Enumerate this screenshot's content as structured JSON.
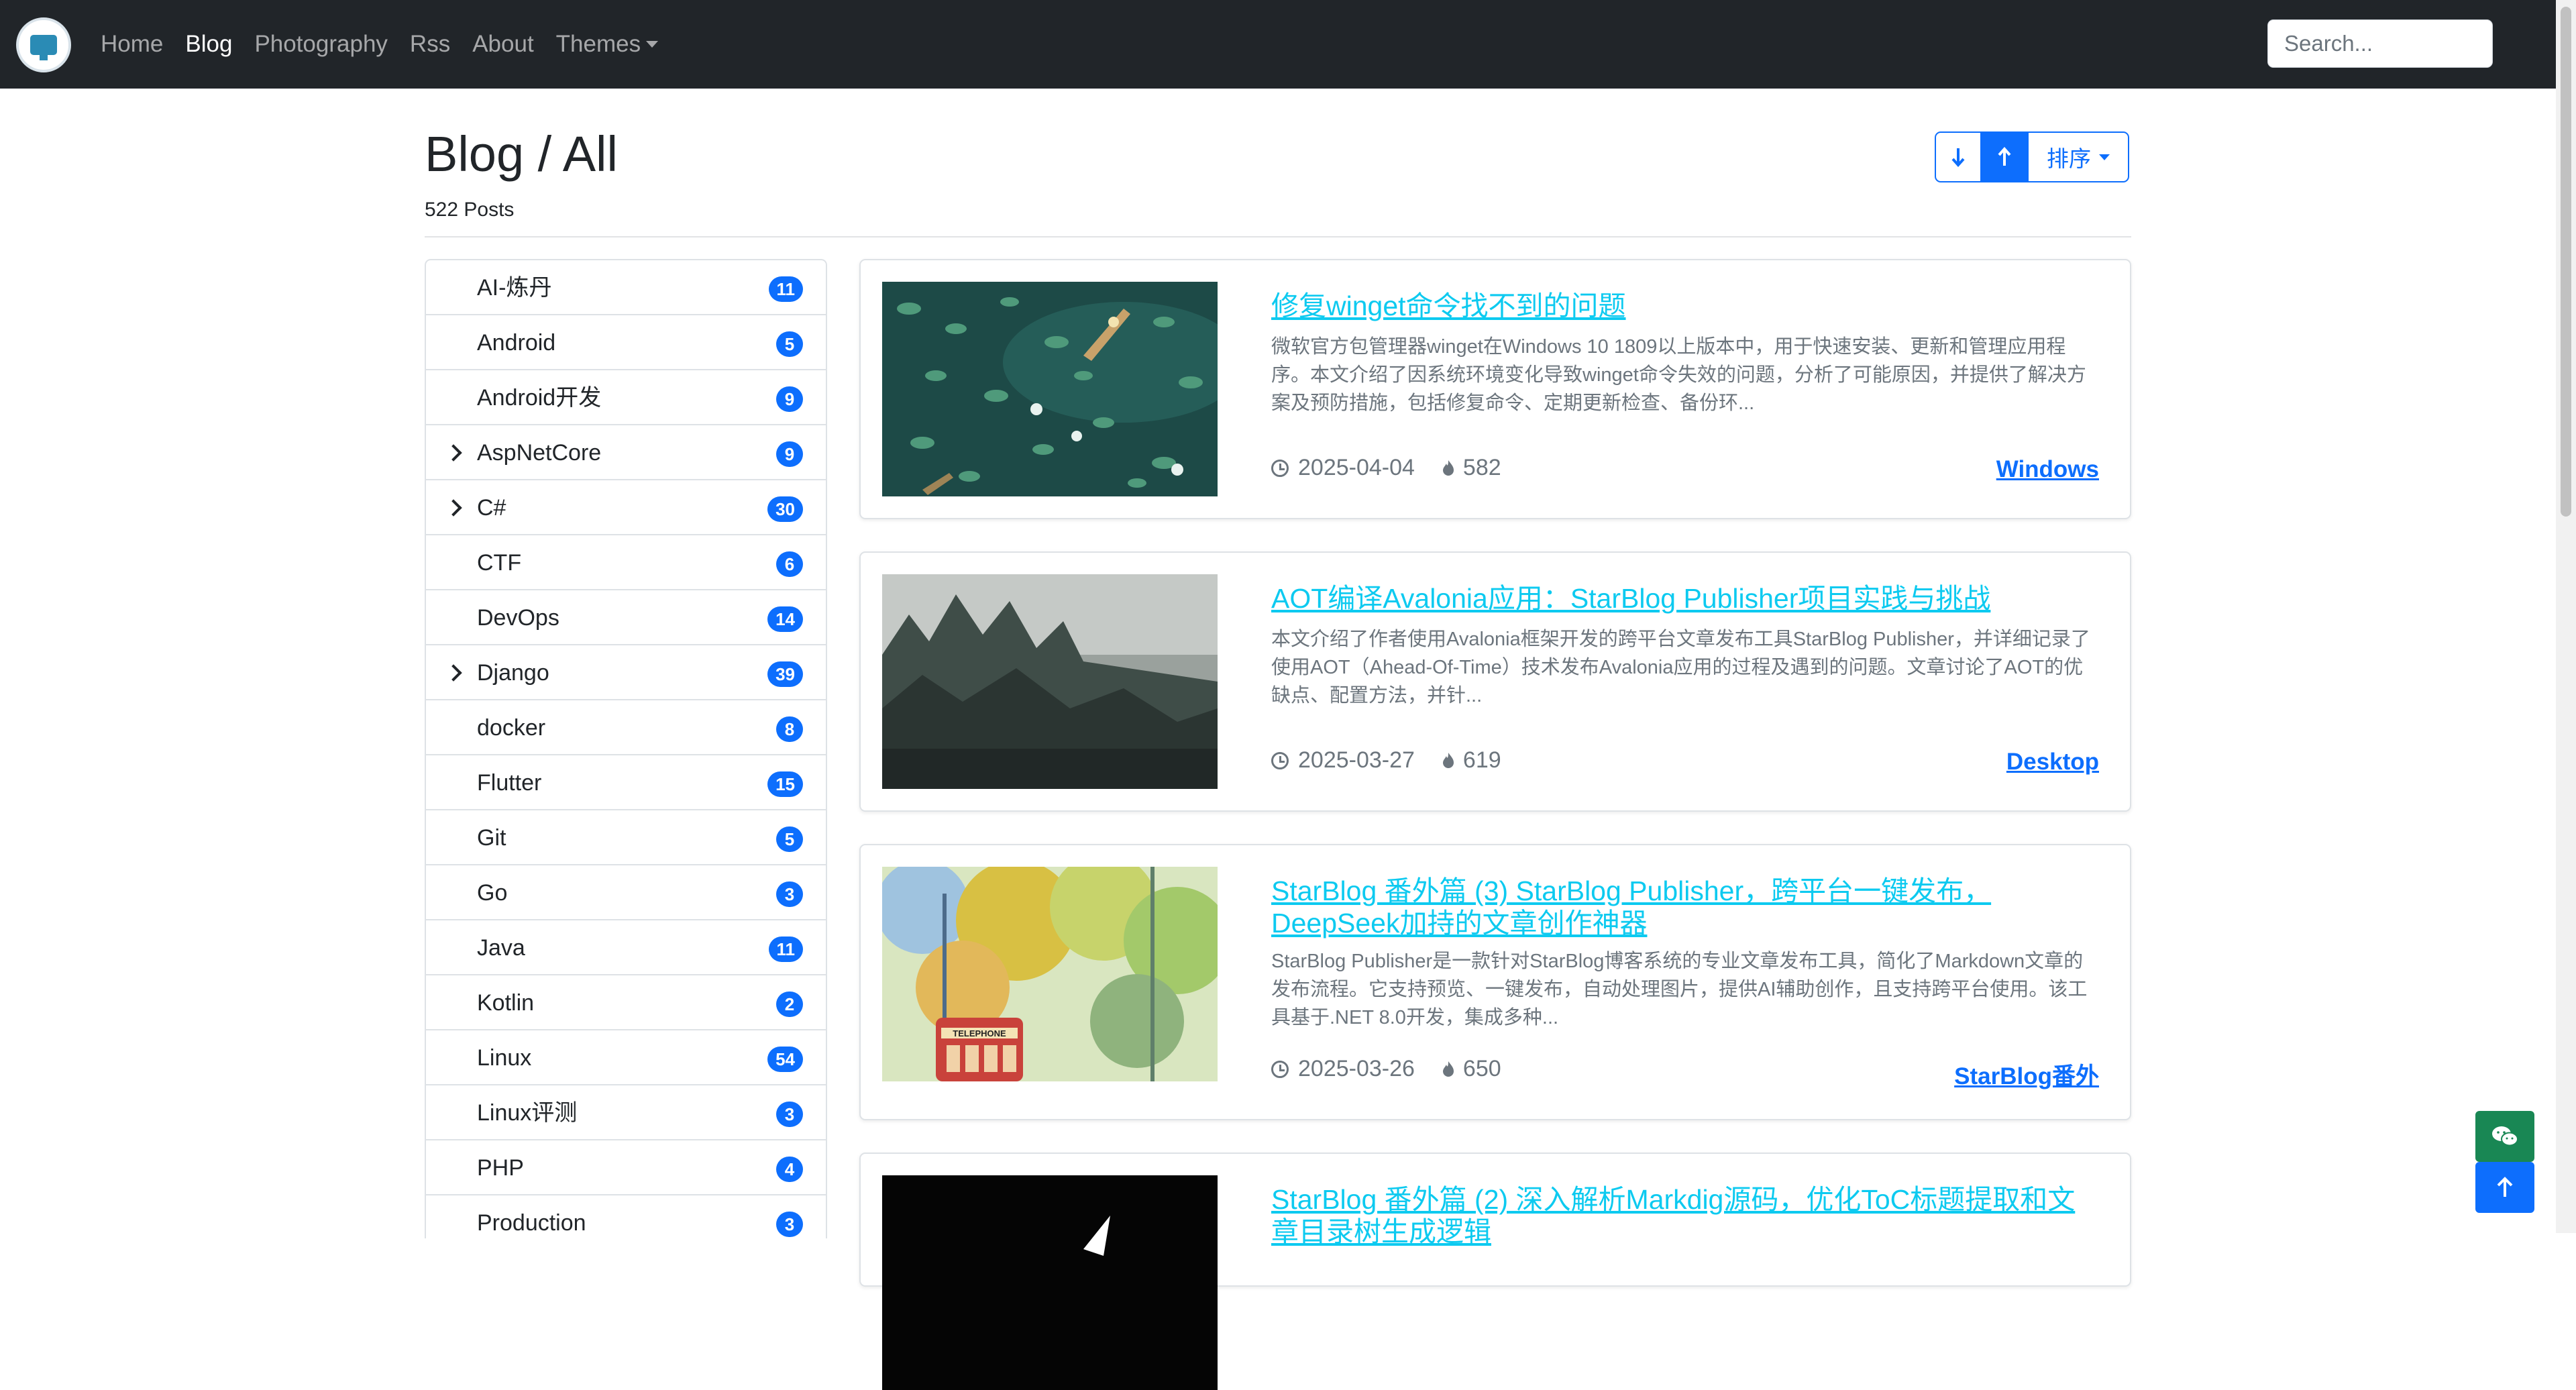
{
  "nav": {
    "brand_icon": "site-logo",
    "links": [
      {
        "label": "Home",
        "active": false
      },
      {
        "label": "Blog",
        "active": true
      },
      {
        "label": "Photography",
        "active": false
      },
      {
        "label": "Rss",
        "active": false
      },
      {
        "label": "About",
        "active": false
      },
      {
        "label": "Themes",
        "active": false,
        "dropdown": true
      }
    ],
    "search_placeholder": "Search..."
  },
  "header": {
    "title": "Blog / All",
    "count": "522 Posts",
    "sort_label": "排序"
  },
  "categories": [
    {
      "label": "AI-炼丹",
      "count": "11",
      "expandable": false
    },
    {
      "label": "Android",
      "count": "5",
      "expandable": false
    },
    {
      "label": "Android开发",
      "count": "9",
      "expandable": false
    },
    {
      "label": "AspNetCore",
      "count": "9",
      "expandable": true
    },
    {
      "label": "C#",
      "count": "30",
      "expandable": true
    },
    {
      "label": "CTF",
      "count": "6",
      "expandable": false
    },
    {
      "label": "DevOps",
      "count": "14",
      "expandable": false
    },
    {
      "label": "Django",
      "count": "39",
      "expandable": true
    },
    {
      "label": "docker",
      "count": "8",
      "expandable": false
    },
    {
      "label": "Flutter",
      "count": "15",
      "expandable": false
    },
    {
      "label": "Git",
      "count": "5",
      "expandable": false
    },
    {
      "label": "Go",
      "count": "3",
      "expandable": false
    },
    {
      "label": "Java",
      "count": "11",
      "expandable": false
    },
    {
      "label": "Kotlin",
      "count": "2",
      "expandable": false
    },
    {
      "label": "Linux",
      "count": "54",
      "expandable": false
    },
    {
      "label": "Linux评测",
      "count": "3",
      "expandable": false
    },
    {
      "label": "PHP",
      "count": "4",
      "expandable": false
    },
    {
      "label": "Production",
      "count": "3",
      "expandable": false
    }
  ],
  "posts": [
    {
      "title": "修复winget命令找不到的问题",
      "description": "微软官方包管理器winget在Windows 10 1809以上版本中，用于快速安装、更新和管理应用程序。本文介绍了因系统环境变化导致winget命令失效的问题，分析了可能原因，并提供了解决方案及预防措施，包括修复命令、定期更新检查、备份环...",
      "date": "2025-04-04",
      "views": "582",
      "category": "Windows"
    },
    {
      "title": "AOT编译Avalonia应用：StarBlog Publisher项目实践与挑战",
      "description": "本文介绍了作者使用Avalonia框架开发的跨平台文章发布工具StarBlog Publisher，并详细记录了使用AOT（Ahead-Of-Time）技术发布Avalonia应用的过程及遇到的问题。文章讨论了AOT的优缺点、配置方法，并针...",
      "date": "2025-03-27",
      "views": "619",
      "category": "Desktop"
    },
    {
      "title": "StarBlog 番外篇 (3) StarBlog Publisher，跨平台一键发布，DeepSeek加持的文章创作神器",
      "description": "StarBlog Publisher是一款针对StarBlog博客系统的专业文章发布工具，简化了Markdown文章的发布流程。它支持预览、一键发布，自动处理图片，提供AI辅助创作，且支持跨平台使用。该工具基于.NET 8.0开发，集成多种...",
      "date": "2025-03-26",
      "views": "650",
      "category": "StarBlog番外"
    },
    {
      "title": "StarBlog 番外篇 (2) 深入解析Markdig源码，优化ToC标题提取和文章目录树生成逻辑",
      "description": "",
      "date": "",
      "views": "",
      "category": ""
    }
  ],
  "floating": {
    "wechat_icon": "wechat-icon",
    "top_icon": "arrow-up-icon"
  },
  "colors": {
    "navbar": "#212529",
    "primary": "#0d6efd",
    "link_title": "#0dcaf0",
    "wechat": "#198754"
  }
}
